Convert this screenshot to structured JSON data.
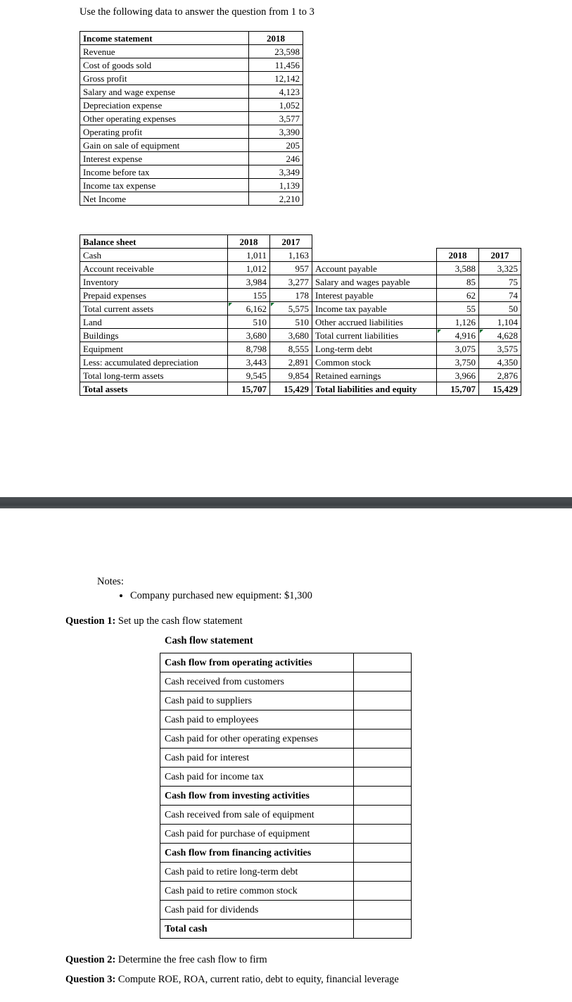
{
  "intro": "Use the following data to answer the question from 1 to 3",
  "income_statement": {
    "header_label": "Income statement",
    "header_year": "2018",
    "rows": [
      {
        "label": "Revenue",
        "value": "23,598"
      },
      {
        "label": "Cost of goods sold",
        "value": "11,456"
      },
      {
        "label": "Gross profit",
        "value": "12,142"
      },
      {
        "label": "Salary and wage expense",
        "value": "4,123"
      },
      {
        "label": "Depreciation expense",
        "value": "1,052"
      },
      {
        "label": "Other operating expenses",
        "value": "3,577"
      },
      {
        "label": "Operating profit",
        "value": "3,390"
      },
      {
        "label": "Gain on sale of equipment",
        "value": "205"
      },
      {
        "label": "Interest expense",
        "value": "246"
      },
      {
        "label": "Income before tax",
        "value": "3,349"
      },
      {
        "label": "Income tax expense",
        "value": "1,139"
      },
      {
        "label": "Net Income",
        "value": "2,210"
      }
    ]
  },
  "balance_sheet": {
    "header_label": "Balance sheet",
    "header_2018": "2018",
    "header_2017": "2017",
    "assets": [
      {
        "label": "Cash",
        "y2018": "1,011",
        "y2017": "1,163",
        "bold": false,
        "note": false
      },
      {
        "label": "Account receivable",
        "y2018": "1,012",
        "y2017": "957",
        "bold": false,
        "note": false
      },
      {
        "label": "Inventory",
        "y2018": "3,984",
        "y2017": "3,277",
        "bold": false,
        "note": false
      },
      {
        "label": "Prepaid expenses",
        "y2018": "155",
        "y2017": "178",
        "bold": false,
        "note": false
      },
      {
        "label": "Total current assets",
        "y2018": "6,162",
        "y2017": "5,575",
        "bold": false,
        "note": true
      },
      {
        "label": "Land",
        "y2018": "510",
        "y2017": "510",
        "bold": false,
        "note": false
      },
      {
        "label": "Buildings",
        "y2018": "3,680",
        "y2017": "3,680",
        "bold": false,
        "note": false
      },
      {
        "label": "Equipment",
        "y2018": "8,798",
        "y2017": "8,555",
        "bold": false,
        "note": false
      },
      {
        "label": "Less: accumulated depreciation",
        "y2018": "3,443",
        "y2017": "2,891",
        "bold": false,
        "note": false
      },
      {
        "label": "Total long-term assets",
        "y2018": "9,545",
        "y2017": "9,854",
        "bold": false,
        "note": false
      },
      {
        "label": "Total assets",
        "y2018": "15,707",
        "y2017": "15,429",
        "bold": true,
        "note": false
      }
    ],
    "liabilities_header": {
      "y2018": "2018",
      "y2017": "2017"
    },
    "liabilities": [
      {
        "label": "Account payable",
        "y2018": "3,588",
        "y2017": "3,325",
        "bold": false,
        "note": false
      },
      {
        "label": "Salary and wages payable",
        "y2018": "85",
        "y2017": "75",
        "bold": false,
        "note": false
      },
      {
        "label": "Interest payable",
        "y2018": "62",
        "y2017": "74",
        "bold": false,
        "note": false
      },
      {
        "label": "Income tax payable",
        "y2018": "55",
        "y2017": "50",
        "bold": false,
        "note": false
      },
      {
        "label": "Other accrued liabilities",
        "y2018": "1,126",
        "y2017": "1,104",
        "bold": false,
        "note": false
      },
      {
        "label": "Total current liabilities",
        "y2018": "4,916",
        "y2017": "4,628",
        "bold": false,
        "note": true
      },
      {
        "label": "Long-term debt",
        "y2018": "3,075",
        "y2017": "3,575",
        "bold": false,
        "note": false
      },
      {
        "label": "Common stock",
        "y2018": "3,750",
        "y2017": "4,350",
        "bold": false,
        "note": false
      },
      {
        "label": "Retained earnings",
        "y2018": "3,966",
        "y2017": "2,876",
        "bold": false,
        "note": false
      },
      {
        "label": "Total liabilities and equity",
        "y2018": "15,707",
        "y2017": "15,429",
        "bold": true,
        "note": false
      }
    ]
  },
  "notes": {
    "label": "Notes:",
    "items": [
      "Company purchased new equipment: $1,300"
    ]
  },
  "questions": {
    "q1_prefix": "Question 1:",
    "q1_text": " Set up the cash flow statement",
    "q2_prefix": "Question 2:",
    "q2_text": " Determine the free cash flow to firm",
    "q3_prefix": "Question 3:",
    "q3_text": " Compute ROE, ROA, current ratio, debt to equity, financial leverage"
  },
  "cash_flow": {
    "title": "Cash flow statement",
    "rows": [
      {
        "label": "Cash flow from operating activities",
        "value": "",
        "bold": true
      },
      {
        "label": "Cash received from customers",
        "value": "",
        "bold": false
      },
      {
        "label": "Cash paid to suppliers",
        "value": "",
        "bold": false
      },
      {
        "label": "Cash paid to employees",
        "value": "",
        "bold": false
      },
      {
        "label": "Cash paid for other operating expenses",
        "value": "",
        "bold": false
      },
      {
        "label": "Cash paid for interest",
        "value": "",
        "bold": false
      },
      {
        "label": "Cash paid for income tax",
        "value": "",
        "bold": false
      },
      {
        "label": "Cash flow from investing activities",
        "value": "",
        "bold": true
      },
      {
        "label": "Cash received from sale of equipment",
        "value": "",
        "bold": false
      },
      {
        "label": "Cash paid for purchase of equipment",
        "value": "",
        "bold": false
      },
      {
        "label": "Cash flow from financing activities",
        "value": "",
        "bold": true
      },
      {
        "label": "Cash paid to retire long-term debt",
        "value": "",
        "bold": false
      },
      {
        "label": "Cash paid to retire common stock",
        "value": "",
        "bold": false
      },
      {
        "label": "Cash paid for dividends",
        "value": "",
        "bold": false
      },
      {
        "label": "Total cash",
        "value": "",
        "bold": true
      }
    ]
  },
  "colors": {
    "divider_bar": "#45494d",
    "note_marker": "#0a6b2a",
    "table_border": "#000000"
  }
}
